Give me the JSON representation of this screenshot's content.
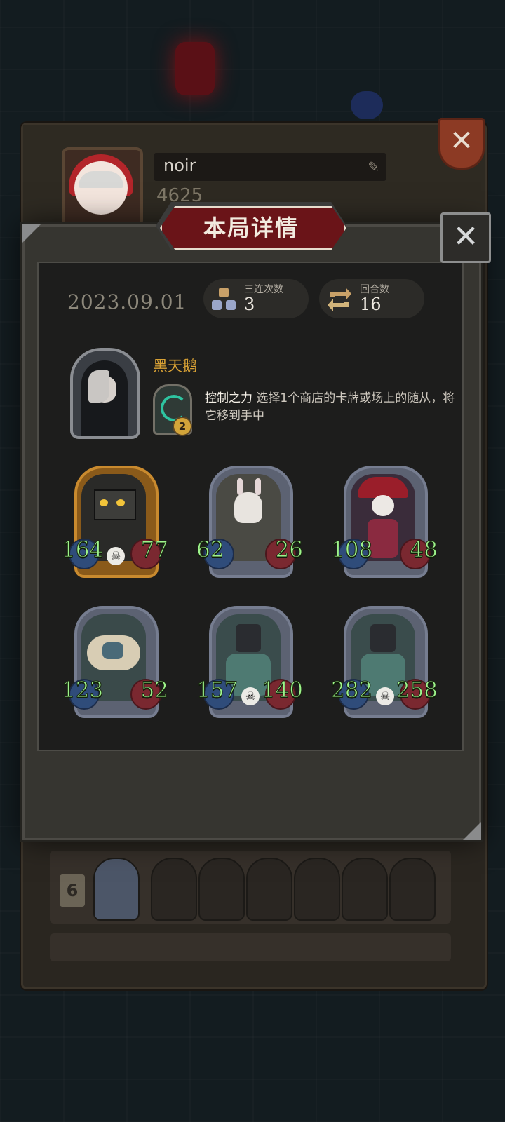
{
  "background": {
    "profile": {
      "name": "noir",
      "gold": "4625",
      "history_rank": "6"
    }
  },
  "modal": {
    "title": "本局详情",
    "date": "2023.09.01",
    "stats": [
      {
        "label": "三连次数",
        "value": "3",
        "icon": "triple-icon"
      },
      {
        "label": "回合数",
        "value": "16",
        "icon": "turns-icon"
      }
    ],
    "hero": {
      "name": "黑天鹅",
      "skill_name": "控制之力",
      "skill_desc": " 选择1个商店的卡牌或场上的随从，将它移到手中",
      "skill_level": "2"
    },
    "minions": [
      {
        "attack": "164",
        "health": "77",
        "golden": true,
        "skull": true
      },
      {
        "attack": "62",
        "health": "26",
        "golden": false,
        "skull": false
      },
      {
        "attack": "108",
        "health": "48",
        "golden": false,
        "skull": false
      },
      {
        "attack": "123",
        "health": "52",
        "golden": false,
        "skull": false
      },
      {
        "attack": "157",
        "health": "140",
        "golden": false,
        "skull": true
      },
      {
        "attack": "282",
        "health": "258",
        "golden": false,
        "skull": true
      }
    ]
  },
  "colors": {
    "attack_text": "#9ef48c",
    "hero_name": "#d9a235",
    "banner": "#6a1418"
  }
}
